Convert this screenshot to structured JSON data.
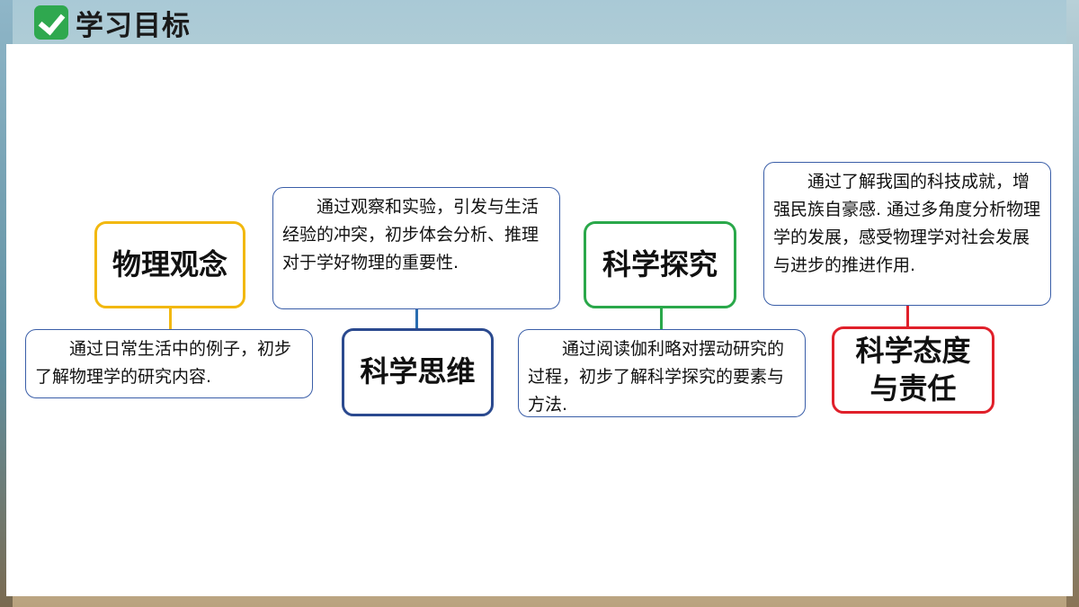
{
  "header": {
    "title": "学习目标",
    "icon": "check-icon"
  },
  "concepts": [
    {
      "label": "物理观念",
      "color": "#f2b80f",
      "description": "通过日常生活中的例子，初步了解物理学的研究内容."
    },
    {
      "label": "科学思维",
      "color": "#2b4a8f",
      "description": "通过观察和实验，引发与生活经验的冲突，初步体会分析、推理对于学好物理的重要性."
    },
    {
      "label": "科学探究",
      "color": "#2aa84a",
      "description": "通过阅读伽利略对摆动研究的过程，初步了解科学探究的要素与方法."
    },
    {
      "label": "科学态度与责任",
      "color": "#e0202a",
      "description": "通过了解我国的科技成就，增强民族自豪感. 通过多角度分析物理学的发展，感受物理学对社会发展与进步的推进作用."
    }
  ],
  "colors": {
    "desc_border": "#3a5ea8",
    "connector": "#2a6db0"
  }
}
